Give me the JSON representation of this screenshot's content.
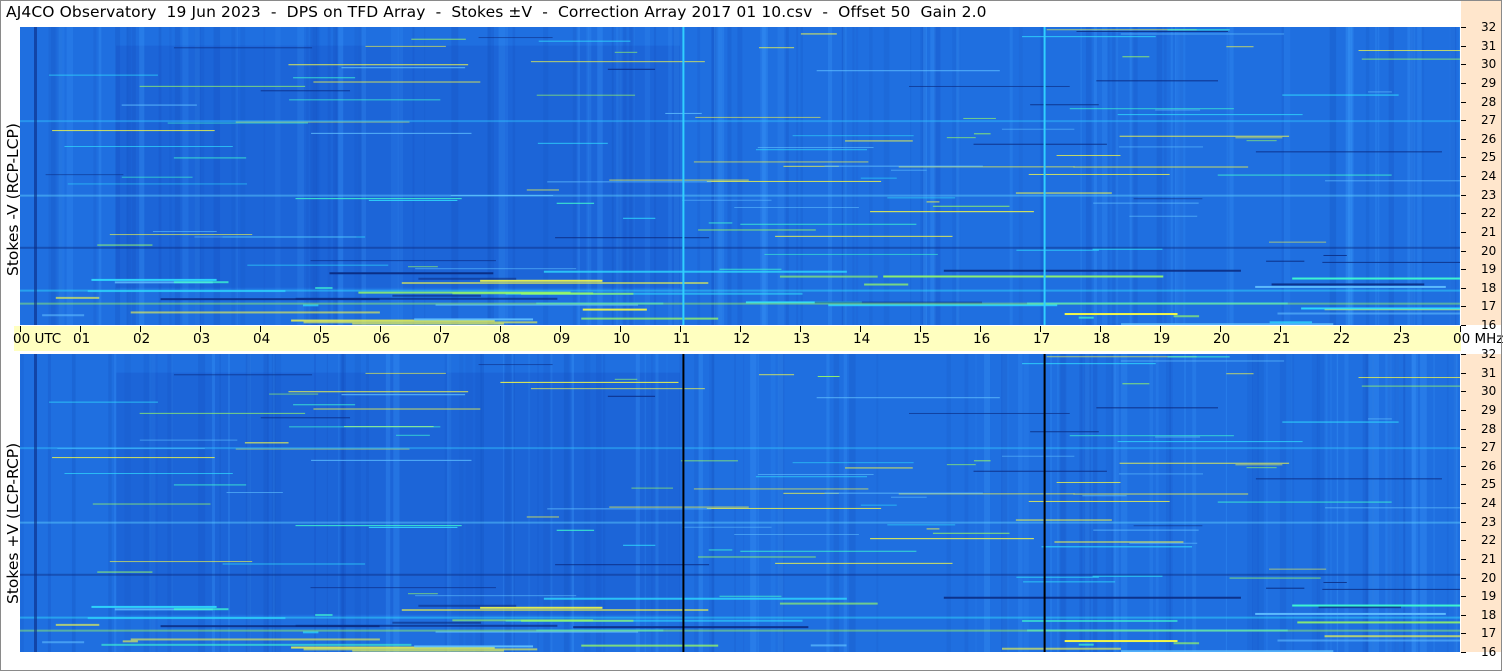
{
  "title": "AJ4CO Observatory  19 Jun 2023  -  DPS on TFD Array  -  Stokes ±V  -  Correction Array 2017 01 10.csv  -  Offset 50  Gain 2.0",
  "top_panel": {
    "ylabel": "Stokes -V (RCP-LCP)"
  },
  "bottom_panel": {
    "ylabel": "Stokes +V (LCP-RCP)"
  },
  "time_axis": {
    "labels": [
      "00 UTC",
      "01",
      "02",
      "03",
      "04",
      "05",
      "06",
      "07",
      "08",
      "09",
      "10",
      "11",
      "12",
      "13",
      "14",
      "15",
      "16",
      "17",
      "18",
      "19",
      "20",
      "21",
      "22",
      "23",
      "00 MHz"
    ]
  },
  "freq_axis": {
    "labels": [
      "32",
      "31",
      "30",
      "29",
      "28",
      "27",
      "26",
      "25",
      "24",
      "23",
      "22",
      "21",
      "20",
      "19",
      "18",
      "17",
      "16"
    ]
  },
  "colors": {
    "background_blue": "#1f6fe0",
    "time_band": "#ffffc0",
    "freq_strip": "#ffe6cc"
  },
  "chart_data": {
    "type": "heatmap",
    "title": "AJ4CO Observatory  19 Jun 2023  -  DPS on TFD Array  -  Stokes ±V  -  Correction Array 2017 01 10.csv  -  Offset 50  Gain 2.0",
    "x_range_utc_hours": [
      0,
      24
    ],
    "y_range_mhz": [
      16,
      32
    ],
    "panels": [
      {
        "name": "Stokes -V (RCP-LCP)",
        "vertical_lines_utc": [
          11.04,
          17.06
        ],
        "line_color": "#30d0ff"
      },
      {
        "name": "Stokes +V (LCP-RCP)",
        "vertical_lines_utc": [
          11.04,
          17.06
        ],
        "line_color": "#000000"
      }
    ],
    "x_ticks": [
      0,
      1,
      2,
      3,
      4,
      5,
      6,
      7,
      8,
      9,
      10,
      11,
      12,
      13,
      14,
      15,
      16,
      17,
      18,
      19,
      20,
      21,
      22,
      23,
      24
    ],
    "y_ticks": [
      32,
      31,
      30,
      29,
      28,
      27,
      26,
      25,
      24,
      23,
      22,
      21,
      20,
      19,
      18,
      17,
      16
    ]
  }
}
